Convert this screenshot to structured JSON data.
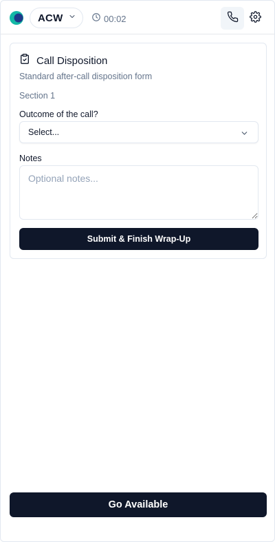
{
  "header": {
    "status_label": "ACW",
    "timer": "00:02",
    "logo_colors": {
      "primary": "#14b8a6",
      "secondary": "#1e3a8a"
    }
  },
  "card": {
    "title": "Call Disposition",
    "subtitle": "Standard after-call disposition form",
    "section": "Section 1",
    "outcome_label": "Outcome of the call?",
    "outcome_value": "Select...",
    "notes_label": "Notes",
    "notes_placeholder": "Optional notes...",
    "notes_value": "",
    "submit_label": "Submit & Finish Wrap-Up"
  },
  "footer": {
    "go_available_label": "Go Available"
  },
  "icons": {
    "logo": "app-logo",
    "status_dropdown": "chevron-down-icon",
    "timer": "clock-icon",
    "phone": "phone-icon",
    "settings": "gear-icon",
    "card_title": "clipboard-check-icon",
    "select": "chevron-down-icon"
  },
  "colors": {
    "primary_button": "#0f172a",
    "muted_text": "#64748b",
    "border": "#e2e8f0"
  }
}
